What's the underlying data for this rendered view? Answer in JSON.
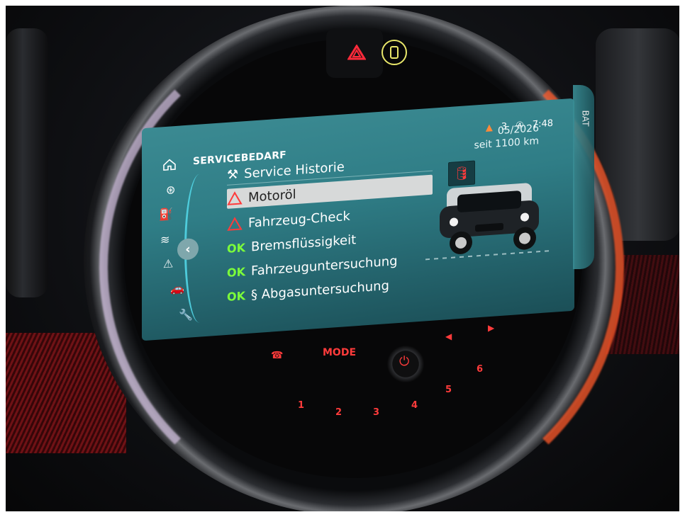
{
  "hardware": {
    "mode_label": "MODE",
    "preset_numbers": [
      "1",
      "2",
      "3",
      "4",
      "5",
      "6"
    ]
  },
  "screen": {
    "title": "SERVICEBEDARF",
    "status": {
      "warning_count": "3",
      "clock": "7:48"
    },
    "service_info": {
      "date": "05/2026",
      "distance": "seit 1100 km"
    },
    "menu": {
      "history_label": "Service Historie",
      "items": [
        {
          "status": "warning",
          "label": "Motoröl"
        },
        {
          "status": "warning",
          "label": "Fahrzeug-Check"
        },
        {
          "status": "ok",
          "ok_text": "OK",
          "label": "Bremsflüssigkeit"
        },
        {
          "status": "ok",
          "ok_text": "OK",
          "label": "Fahrzeuguntersuchung"
        },
        {
          "status": "ok",
          "ok_text": "OK",
          "label": "§ Abgasuntersuchung"
        }
      ]
    },
    "right_edge_text": "BAT"
  },
  "icons": [
    "home-icon",
    "tyre-pressure-icon",
    "oil-can-icon",
    "coolant-icon",
    "warning-icon",
    "car-icon",
    "wrench-icon",
    "back-chevron-icon",
    "hazard-icon",
    "door-open-icon",
    "oil-warning-icon",
    "power-icon",
    "phone-icon"
  ],
  "colors": {
    "screen": "#2f7d86",
    "ok": "#7cff3a",
    "warning": "#ff3b3b",
    "selection": "#d7d9d9",
    "hazard": "#ff2a3a",
    "door": "#e8e66a"
  }
}
